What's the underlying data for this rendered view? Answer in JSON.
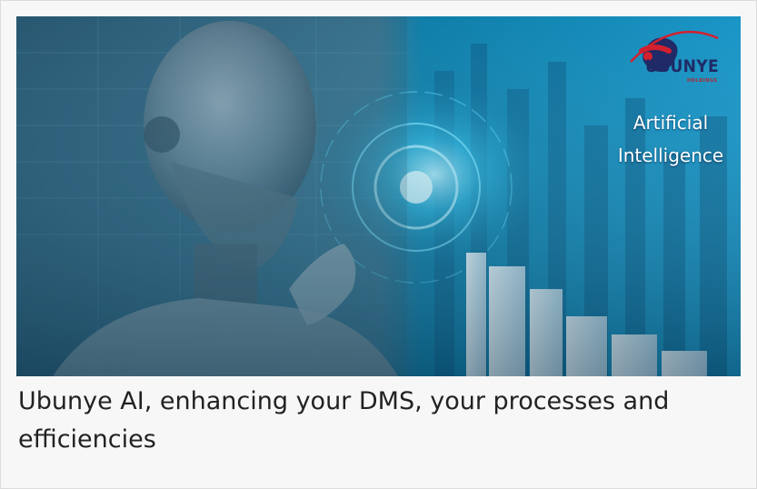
{
  "hero": {
    "logo_text": "UBUNYE",
    "logo_subtext": "HOLDINGS",
    "overlay_line1": "Artificial",
    "overlay_line2": "Intelligence"
  },
  "caption": "Ubunye AI, enhancing your DMS, your processes and efficiencies"
}
